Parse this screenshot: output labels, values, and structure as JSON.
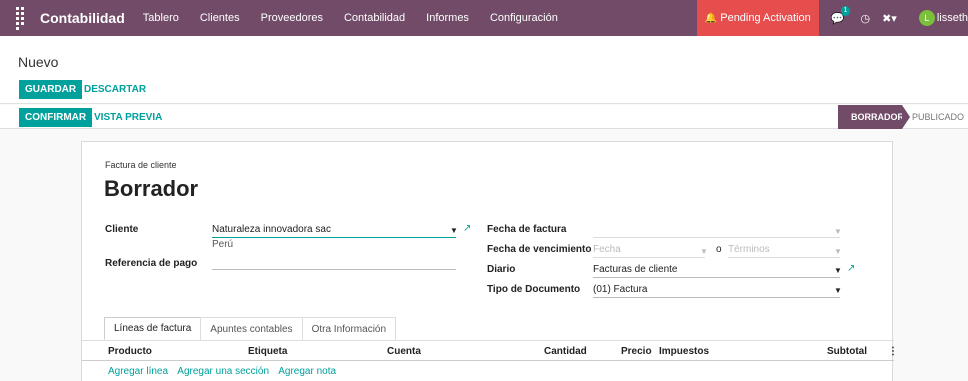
{
  "navbar": {
    "brand": "Contabilidad",
    "menu": [
      "Tablero",
      "Clientes",
      "Proveedores",
      "Contabilidad",
      "Informes",
      "Configuración"
    ],
    "pending": "Pending Activation",
    "messages_badge": "1",
    "avatar_letter": "L",
    "user": "lisseth"
  },
  "control": {
    "breadcrumb": "Nuevo",
    "save": "GUARDAR",
    "discard": "DESCARTAR"
  },
  "statusbar": {
    "confirm": "CONFIRMAR",
    "preview": "VISTA PREVIA",
    "stages": [
      "BORRADOR",
      "PUBLICADO"
    ]
  },
  "sheet": {
    "doc_type": "Factura de cliente",
    "doc_name": "Borrador",
    "left": {
      "cliente_label": "Cliente",
      "cliente_value": "Naturaleza innovadora sac",
      "cliente_country": "Perú",
      "ref_label": "Referencia de pago",
      "ref_value": ""
    },
    "right": {
      "fecha_factura_label": "Fecha de factura",
      "fecha_factura_value": "",
      "vencimiento_label": "Fecha de vencimiento",
      "vencimiento_placeholder": "Fecha",
      "o": "o",
      "terminos_placeholder": "Términos",
      "diario_label": "Diario",
      "diario_value": "Facturas de cliente",
      "tipo_label": "Tipo de Documento",
      "tipo_value": "(01) Factura"
    },
    "tabs": [
      "Líneas de factura",
      "Apuntes contables",
      "Otra Información"
    ],
    "columns": [
      "Producto",
      "Etiqueta",
      "Cuenta",
      "Cantidad",
      "Precio",
      "Impuestos",
      "Subtotal"
    ],
    "add_links": [
      "Agregar línea",
      "Agregar una sección",
      "Agregar nota"
    ]
  }
}
